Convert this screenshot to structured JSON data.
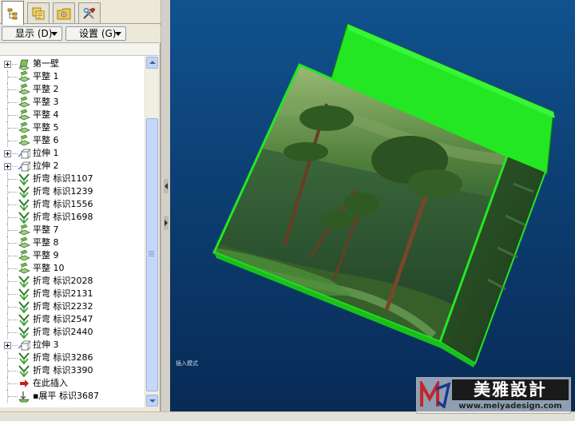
{
  "panel": {
    "tabs": [
      "feature-tree-tab",
      "properties-tab",
      "configuration-tab",
      "tools-tab"
    ],
    "display_button": "显示 (D)",
    "settings_button": "设置 (G)"
  },
  "tree": {
    "items": [
      {
        "icon": "base-flange-icon",
        "label": "第一壁",
        "expandable": true
      },
      {
        "icon": "flatten-icon",
        "label": "平整 1",
        "expandable": false
      },
      {
        "icon": "flatten-icon",
        "label": "平整 2",
        "expandable": false
      },
      {
        "icon": "flatten-icon",
        "label": "平整 3",
        "expandable": false
      },
      {
        "icon": "flatten-icon",
        "label": "平整 4",
        "expandable": false
      },
      {
        "icon": "flatten-icon",
        "label": "平整 5",
        "expandable": false
      },
      {
        "icon": "flatten-icon",
        "label": "平整 6",
        "expandable": false
      },
      {
        "icon": "extrude-icon",
        "label": "拉伸 1",
        "expandable": true
      },
      {
        "icon": "extrude-icon",
        "label": "拉伸 2",
        "expandable": true
      },
      {
        "icon": "bend-icon",
        "label": "折弯 标识1107",
        "expandable": false
      },
      {
        "icon": "bend-icon",
        "label": "折弯 标识1239",
        "expandable": false
      },
      {
        "icon": "bend-icon",
        "label": "折弯 标识1556",
        "expandable": false
      },
      {
        "icon": "bend-icon",
        "label": "折弯 标识1698",
        "expandable": false
      },
      {
        "icon": "flatten-icon",
        "label": "平整 7",
        "expandable": false
      },
      {
        "icon": "flatten-icon",
        "label": "平整 8",
        "expandable": false
      },
      {
        "icon": "flatten-icon",
        "label": "平整 9",
        "expandable": false
      },
      {
        "icon": "flatten-icon",
        "label": "平整 10",
        "expandable": false
      },
      {
        "icon": "bend-icon",
        "label": "折弯 标识2028",
        "expandable": false
      },
      {
        "icon": "bend-icon",
        "label": "折弯 标识2131",
        "expandable": false
      },
      {
        "icon": "bend-icon",
        "label": "折弯 标识2232",
        "expandable": false
      },
      {
        "icon": "bend-icon",
        "label": "折弯 标识2547",
        "expandable": false
      },
      {
        "icon": "bend-icon",
        "label": "折弯 标识2440",
        "expandable": false
      },
      {
        "icon": "extrude-icon",
        "label": "拉伸 3",
        "expandable": true
      },
      {
        "icon": "bend-icon",
        "label": "折弯 标识3286",
        "expandable": false
      },
      {
        "icon": "bend-icon",
        "label": "折弯 标识3390",
        "expandable": false
      },
      {
        "icon": "insert-here-arrow-icon",
        "label": "在此插入",
        "expandable": false
      },
      {
        "icon": "unbend-icon",
        "label": "▪展平 标识3687",
        "expandable": false
      }
    ]
  },
  "viewport": {
    "background_top": "#11528e",
    "background_bottom": "#082a56",
    "model_color": "#1fe01f",
    "corner_label": "插入模式"
  },
  "watermark": {
    "brand": "美雅設計",
    "url": "www.meiyadesign.com"
  }
}
